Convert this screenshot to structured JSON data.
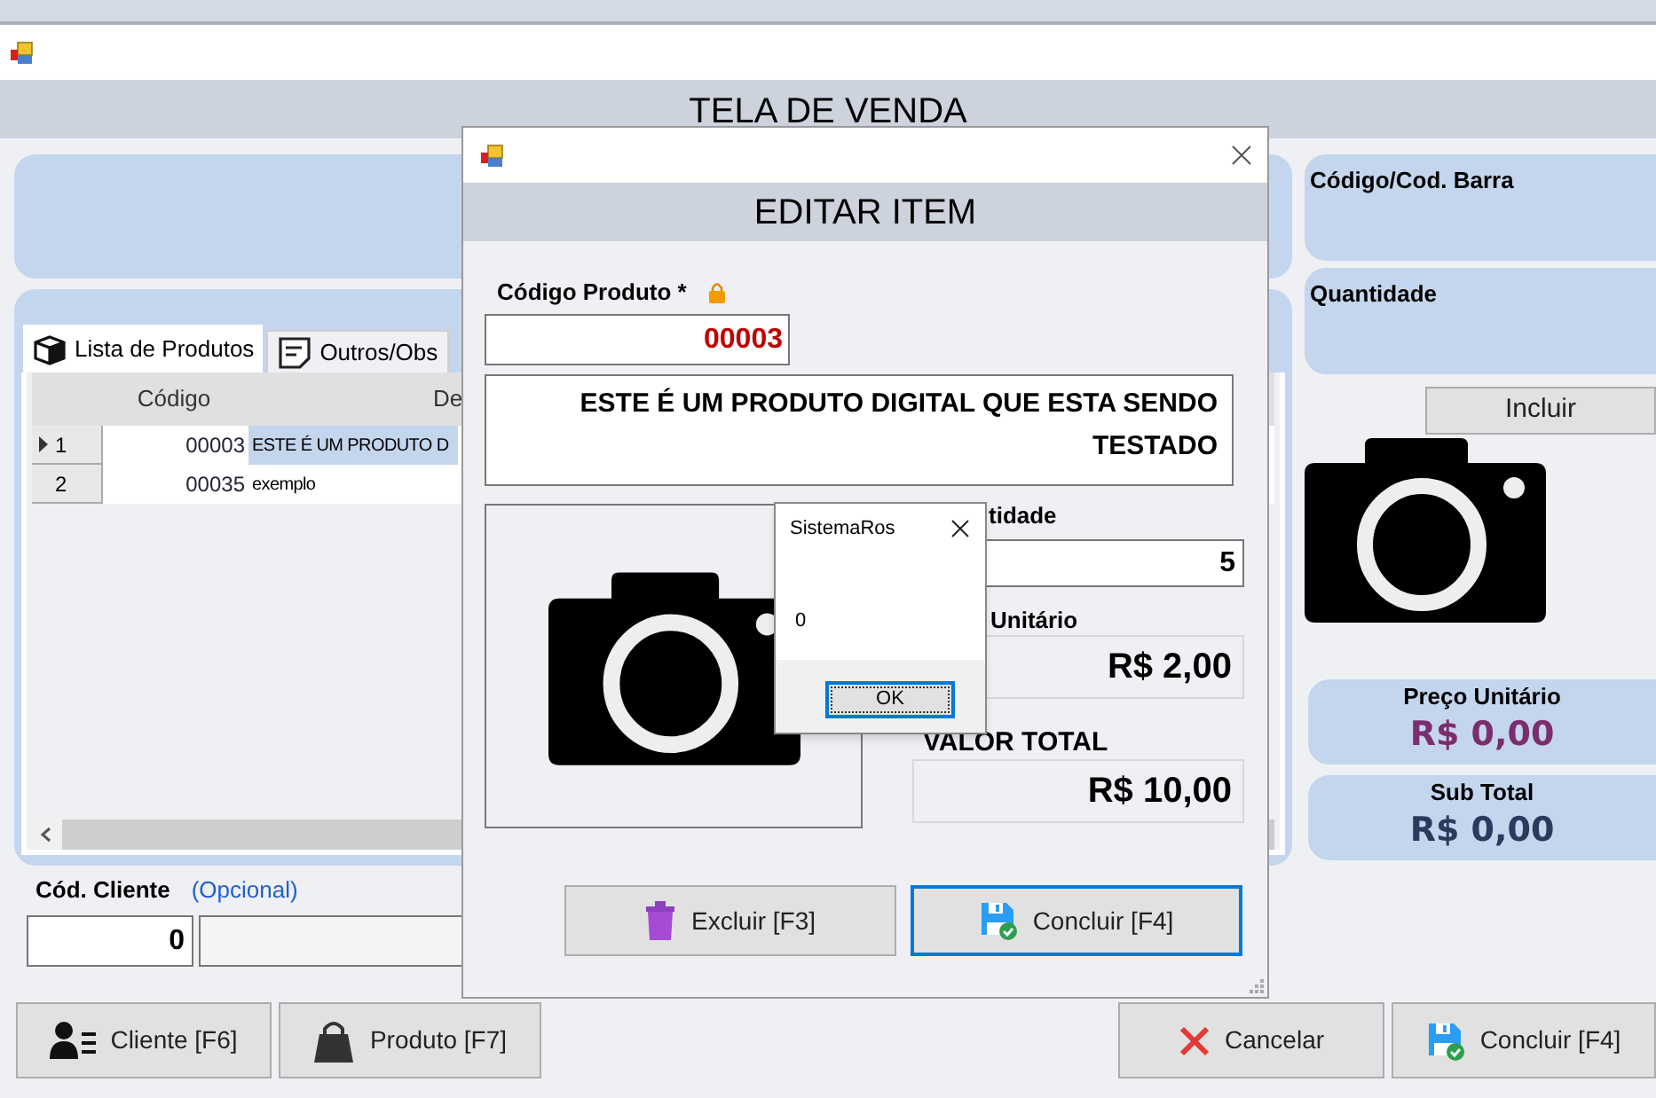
{
  "header": {
    "title": "TELA DE VENDA"
  },
  "tabs": [
    {
      "label": "Lista de Produtos",
      "kind": "box",
      "selected": true
    },
    {
      "label": "Outros/Obs",
      "kind": "note",
      "selected": false
    }
  ],
  "grid": {
    "columns": [
      "Código",
      "De"
    ],
    "rows": [
      {
        "number": "1",
        "code": "00003",
        "description": "ESTE É UM PRODUTO D",
        "selected": true
      },
      {
        "number": "2",
        "code": "00035",
        "description": "exemplo",
        "selected": false
      }
    ]
  },
  "customer": {
    "label": "Cód. Cliente",
    "hint": "(Opcional)",
    "code": "0"
  },
  "right_panel": {
    "barcode_label": "Código/Cod. Barra",
    "quantity_label": "Quantidade",
    "add_button": "Incluir",
    "unit_price": {
      "label": "Preço Unitário",
      "value": "R$ 0,00"
    },
    "subtotal": {
      "label": "Sub Total",
      "value": "R$ 0,00"
    }
  },
  "bottom_buttons": [
    {
      "label": "Cliente [F6]",
      "kind": "client"
    },
    {
      "label": "Produto [F7]",
      "kind": "product"
    },
    {
      "label": "Cancelar",
      "kind": "cancel"
    },
    {
      "label": "Concluir [F4]",
      "kind": "save"
    }
  ],
  "edit_dialog": {
    "title": "EDITAR ITEM",
    "code_label": "Código Produto *",
    "locked": true,
    "code": "00003",
    "description": "ESTE É UM PRODUTO DIGITAL QUE ESTA SENDO TESTADO",
    "quantity_label": "tidade",
    "quantity": "5",
    "unit_price_label": "Unitário",
    "unit_price": "R$ 2,00",
    "total_label": "VALOR TOTAL",
    "total": "R$ 10,00",
    "buttons": [
      {
        "label": "Excluir [F3]",
        "kind": "delete",
        "focused": false
      },
      {
        "label": "Concluir [F4]",
        "kind": "save",
        "focused": true
      }
    ]
  },
  "message_box": {
    "title": "SistemaRos",
    "text": "0",
    "button": "OK"
  }
}
